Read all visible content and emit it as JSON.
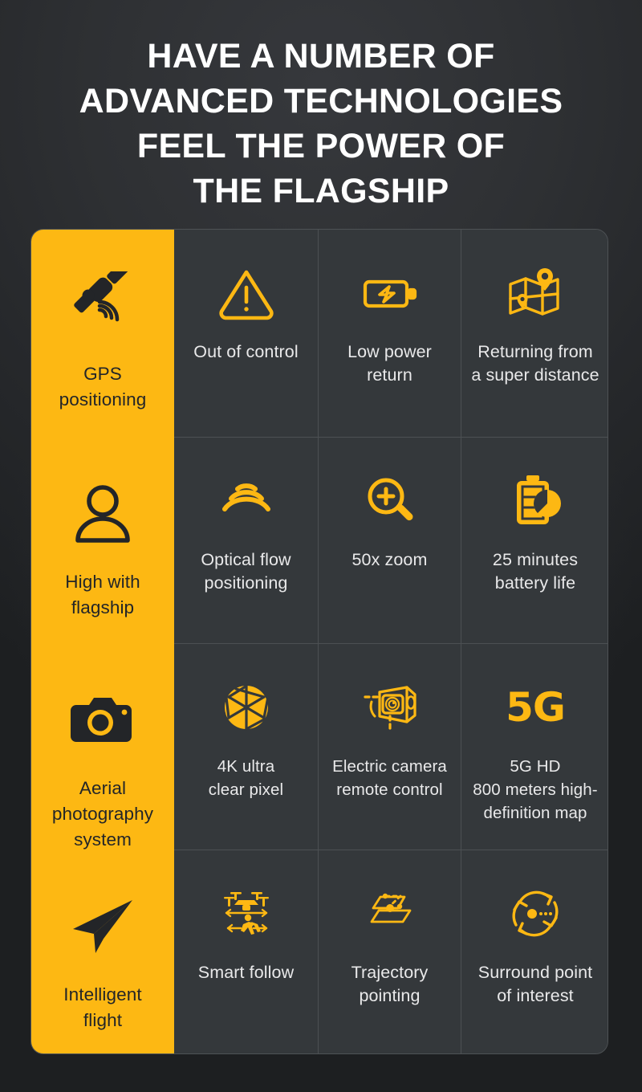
{
  "theme": {
    "accent": "#FDB813",
    "background_dark": "#232528",
    "cell_background": "#34383b",
    "divider": "#4c5053",
    "text_light": "#e9e9ea",
    "text_dark": "#232528"
  },
  "heading": {
    "lines": [
      "HAVE A NUMBER OF",
      "ADVANCED TECHNOLOGIES",
      "FEEL THE POWER OF",
      "THE FLAGSHIP"
    ]
  },
  "grid": {
    "rows": [
      {
        "cells": [
          {
            "label": "GPS\npositioning",
            "icon": "satellite-icon",
            "accent": true
          },
          {
            "label": "Out of control",
            "icon": "warning-triangle-icon",
            "accent": false
          },
          {
            "label": "Low power\nreturn",
            "icon": "battery-bolt-icon",
            "accent": false
          },
          {
            "label": "Returning from\na super distance",
            "icon": "map-pin-icon",
            "accent": false
          }
        ]
      },
      {
        "cells": [
          {
            "label": "High with\nflagship",
            "icon": "person-icon",
            "accent": true
          },
          {
            "label": "Optical flow\npositioning",
            "icon": "signal-waves-icon",
            "accent": false
          },
          {
            "label": "50x zoom",
            "icon": "magnifier-plus-icon",
            "accent": false
          },
          {
            "label": "25 minutes\nbattery life",
            "icon": "battery-clock-icon",
            "accent": false
          }
        ]
      },
      {
        "cells": [
          {
            "label": "Aerial\nphotography\nsystem",
            "icon": "camera-icon",
            "accent": true
          },
          {
            "label": "4K ultra\nclear pixel",
            "icon": "aperture-icon",
            "accent": false
          },
          {
            "label": "Electric camera\nremote control",
            "icon": "gimbal-camera-icon",
            "accent": false
          },
          {
            "label": "5G HD\n800 meters high-\ndefinition map",
            "icon": "5g-text-icon",
            "accent": false,
            "glyph_text": "5G"
          }
        ]
      },
      {
        "cells": [
          {
            "label": "Intelligent\nflight",
            "icon": "paper-plane-icon",
            "accent": true
          },
          {
            "label": "Smart follow",
            "icon": "drone-follow-icon",
            "accent": false
          },
          {
            "label": "Trajectory\npointing",
            "icon": "waypoint-path-icon",
            "accent": false
          },
          {
            "label": "Surround point\nof interest",
            "icon": "orbit-arrows-icon",
            "accent": false
          }
        ]
      }
    ]
  }
}
